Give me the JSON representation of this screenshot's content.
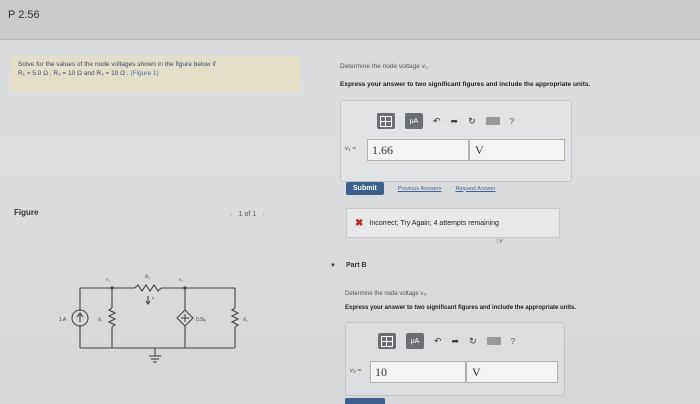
{
  "header": {
    "problem_title": "P 2.56"
  },
  "left": {
    "prompt_line1": "Solve for the values of the node voltages shown in the figure below if",
    "prompt_line2": "R₁ = 5.0 Ω , R₂ = 10 Ω and R₃ = 10 Ω .",
    "figure_link": "(Figure 1)",
    "figure_label": "Figure",
    "pager_text": "1 of 1"
  },
  "circuit": {
    "v1": "v₁",
    "v2": "v₂",
    "r1": "R₁",
    "r2": "R₂",
    "r3": "R₃",
    "source": "1 A",
    "dep_source": "0.5iₑ",
    "current": "iₑ"
  },
  "part_a": {
    "question": "Determine the node voltage v₁.",
    "instruction": "Express your answer to two significant figures and include the appropriate units.",
    "var_label": "v₁ =",
    "value": "1.66",
    "unit": "V",
    "toolbar_mu": "μA",
    "help": "?",
    "submit": "Submit",
    "previous_answers": "Previous Answers",
    "request_answer": "Request Answer",
    "feedback": "Incorrect; Try Again; 4 attempts remaining"
  },
  "part_b": {
    "title": "Part B",
    "question": "Determine the node voltage v₂.",
    "instruction": "Express your answer to two significant figures and include the appropriate units.",
    "var_label": "v₂ =",
    "value": "10",
    "unit": "V",
    "toolbar_mu": "μA",
    "help": "?"
  }
}
